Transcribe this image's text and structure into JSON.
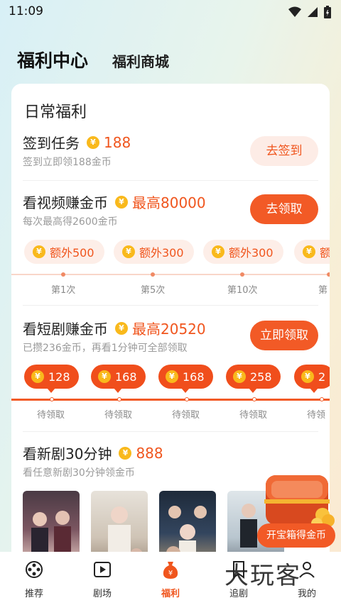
{
  "status_bar": {
    "time": "11:09"
  },
  "header": {
    "tab_main": "福利中心",
    "tab_shop": "福利商城"
  },
  "daily": {
    "title": "日常福利",
    "signin": {
      "title": "签到任务",
      "reward": "188",
      "subtitle": "签到立即领188金币",
      "button": "去签到"
    },
    "video": {
      "title": "看视频赚金币",
      "reward": "最高80000",
      "subtitle": "每次最高得2600金币",
      "button": "去领取",
      "extras": [
        {
          "label": "额外500",
          "tick": "第1次"
        },
        {
          "label": "额外300",
          "tick": "第5次"
        },
        {
          "label": "额外300",
          "tick": "第10次"
        },
        {
          "label": "额",
          "tick": "第"
        }
      ]
    },
    "short_drama": {
      "title": "看短剧赚金币",
      "reward": "最高20520",
      "subtitle": "已攒236金币，再看1分钟可全部领取",
      "button": "立即领取",
      "rewards": [
        {
          "value": "128",
          "status": "待领取"
        },
        {
          "value": "168",
          "status": "待领取"
        },
        {
          "value": "168",
          "status": "待领取"
        },
        {
          "value": "258",
          "status": "待领取"
        },
        {
          "value": "2",
          "status": "待领"
        }
      ]
    },
    "new_drama": {
      "title": "看新剧30分钟",
      "reward": "888",
      "subtitle": "看任意新剧30分钟领金币"
    }
  },
  "chest": {
    "label": "开宝箱得金币"
  },
  "bottom_nav": [
    {
      "label": "推荐",
      "icon": "film-reel-icon"
    },
    {
      "label": "剧场",
      "icon": "play-box-icon"
    },
    {
      "label": "福利",
      "icon": "money-bag-icon",
      "active": true
    },
    {
      "label": "追剧",
      "icon": "bookmark-icon"
    },
    {
      "label": "我的",
      "icon": "profile-icon"
    }
  ],
  "watermark": "大玩客",
  "colors": {
    "accent": "#f25a26",
    "coin": "#f9b91c",
    "active_nav": "#f0551d"
  }
}
